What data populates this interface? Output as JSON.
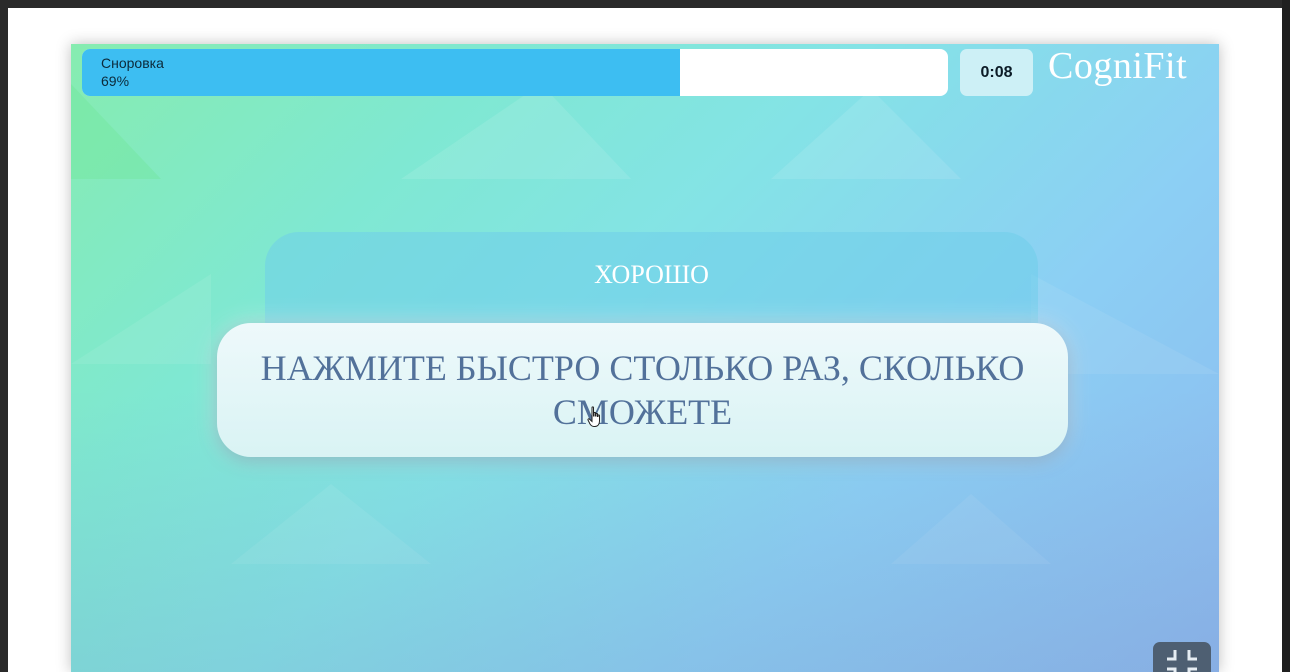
{
  "progress": {
    "label": "Сноровка",
    "percent_text": "69%",
    "fraction": 0.69
  },
  "timer": {
    "value": "0:08"
  },
  "logo": {
    "text": "CogniFit"
  },
  "feedback": {
    "text": "ХОРОШО"
  },
  "instruction": {
    "text": "НАЖМИТЕ БЫСТРО СТОЛЬКО РАЗ, СКОЛЬКО СМОЖЕТЕ"
  },
  "icons": {
    "cursor": "hand-pointer-icon",
    "fullscreen": "exit-fullscreen-icon"
  },
  "colors": {
    "progress_fill": "#3dbef2",
    "instruction_text": "#52719a",
    "fullscreen_button": "#4e5f72"
  }
}
